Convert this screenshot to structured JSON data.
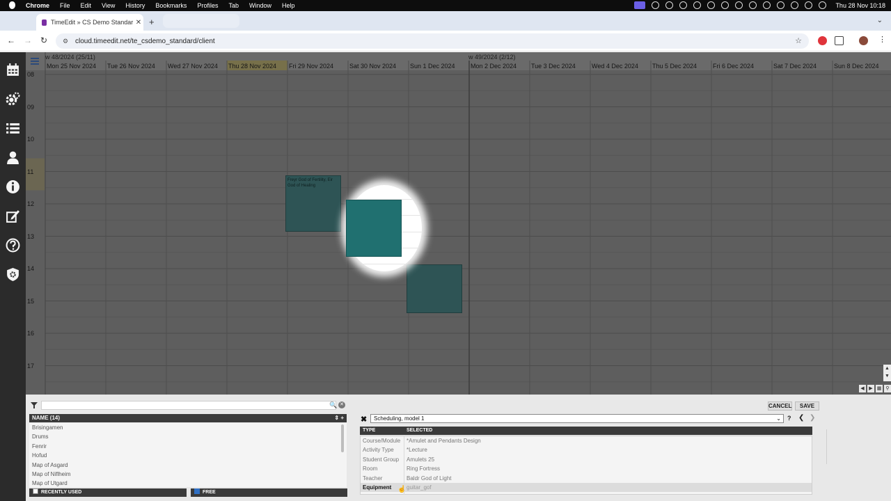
{
  "macbar": {
    "app": "Chrome",
    "menus": [
      "File",
      "Edit",
      "View",
      "History",
      "Bookmarks",
      "Profiles",
      "Tab",
      "Window",
      "Help"
    ],
    "clock": "Thu 28 Nov  10:18"
  },
  "browser": {
    "tab_title": "TimeEdit » CS Demo Standar",
    "url": "cloud.timeedit.net/te_csdemo_standard/client",
    "new_tab": "+"
  },
  "sidebar": {
    "items": [
      "calendar-icon",
      "gears-icon",
      "list-icon",
      "user-icon",
      "info-icon",
      "edit-icon",
      "help-icon",
      "admin-shield-icon"
    ]
  },
  "calendar": {
    "week1_label": "w 48/2024 (25/11)",
    "week2_label": "w 49/2024 (2/12)",
    "days": [
      "Mon 25 Nov 2024",
      "Tue 26 Nov 2024",
      "Wed 27 Nov 2024",
      "Thu 28 Nov 2024",
      "Fri 29 Nov 2024",
      "Sat 30 Nov 2024",
      "Sun 1 Dec 2024",
      "Mon 2 Dec 2024",
      "Tue 3 Dec 2024",
      "Wed 4 Dec 2024",
      "Thu 5 Dec 2024",
      "Fri 6 Dec 2024",
      "Sat 7 Dec 2024",
      "Sun 8 Dec 2024"
    ],
    "hours": [
      "08",
      "09",
      "10",
      "11",
      "12",
      "13",
      "14",
      "15",
      "16",
      "17"
    ],
    "bookings": [
      {
        "label": "Freyr God of Fertility, Eir God of Healing"
      }
    ]
  },
  "object_panel": {
    "name_header": "NAME (14)",
    "header_tools": "⇕ +",
    "items": [
      "Brisingamen",
      "Drums",
      "Fenrir",
      "Hofud",
      "Map of Asgard",
      "Map of Niflheim",
      "Map of Utgard"
    ],
    "recently_used": "RECENTLY USED",
    "free": "FREE"
  },
  "reservation_panel": {
    "cancel": "CANCEL",
    "save": "SAVE",
    "model": "Scheduling, model 1",
    "help": "?",
    "col_type": "TYPE",
    "col_selected": "SELECTED",
    "rows": [
      {
        "type": "Course/Module",
        "value": "*Amulet and Pendants Design"
      },
      {
        "type": "Activity Type",
        "value": "*Lecture"
      },
      {
        "type": "Student Group",
        "value": "Amulets 25"
      },
      {
        "type": "Room",
        "value": "Ring Fortress"
      },
      {
        "type": "Teacher",
        "value": "Baldr God of Light"
      },
      {
        "type": "Equipment",
        "value": "guitar_gof"
      }
    ]
  },
  "colors": {
    "booking": "#2e5455",
    "booking_highlight": "#207070",
    "calendar_dim": "#5e5e5e",
    "sidebar": "#2b2b2b"
  }
}
